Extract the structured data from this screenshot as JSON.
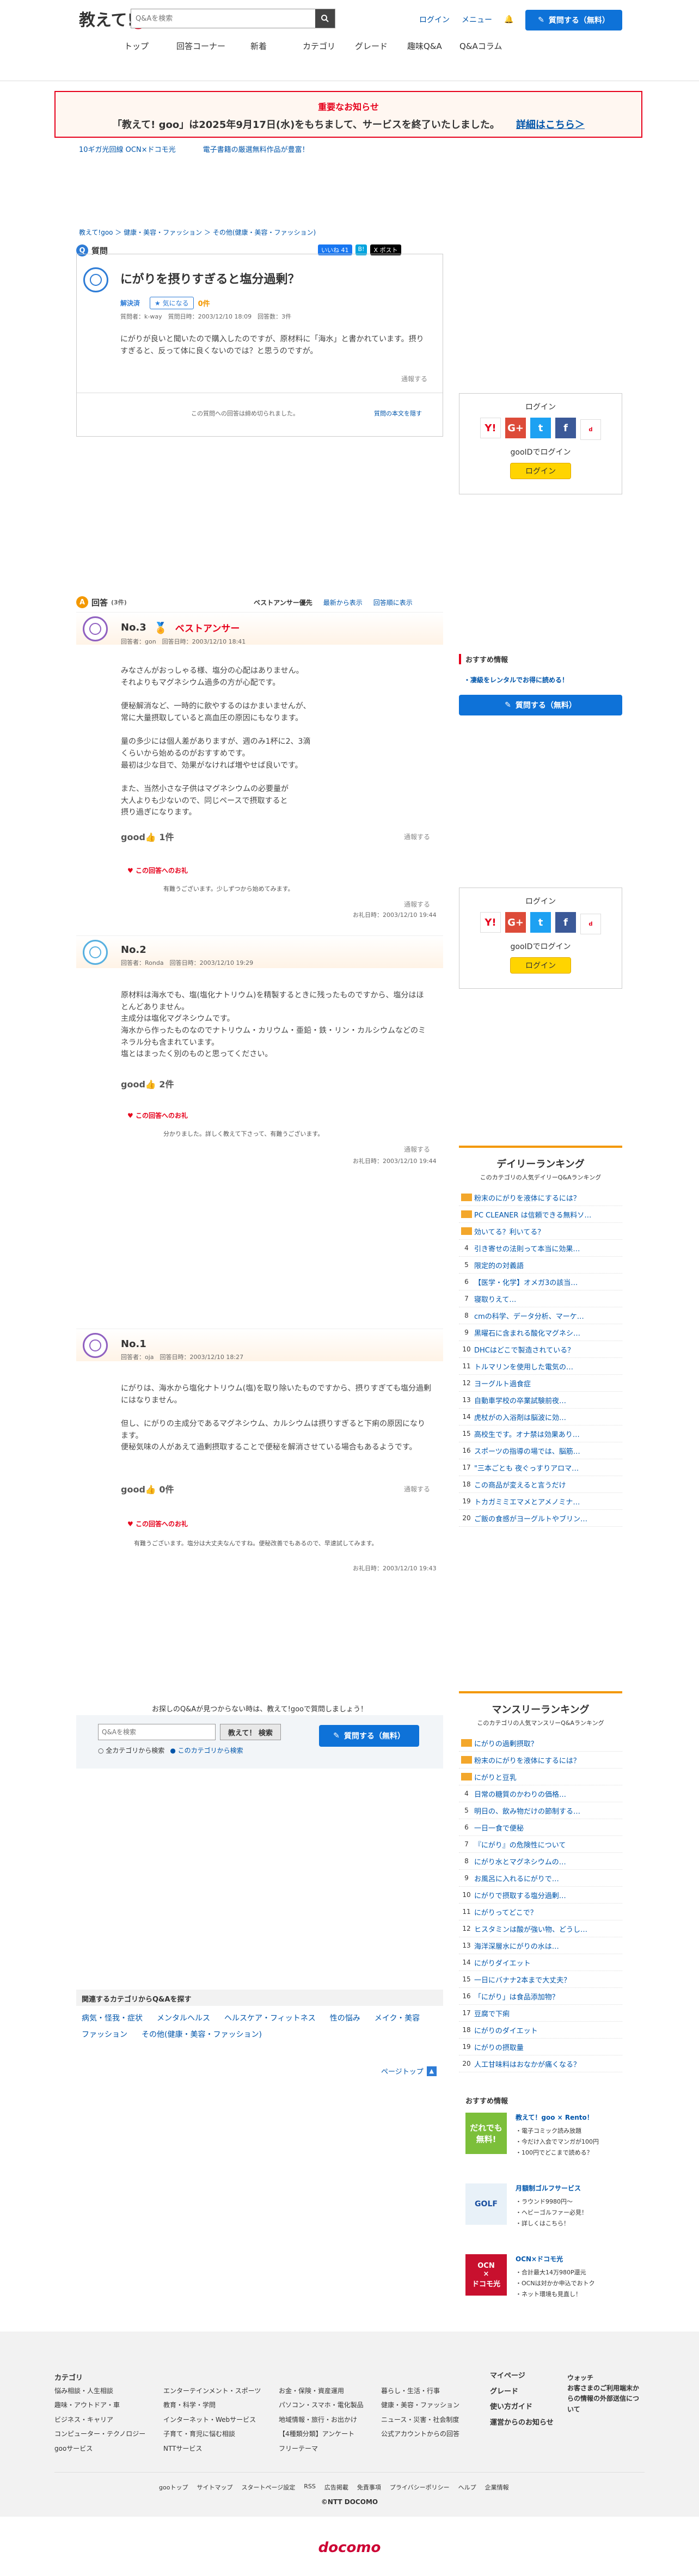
{
  "header": {
    "logo_prefix": "教えて!",
    "logo_brand": "goo",
    "search_placeholder": "Q&Aを検索",
    "login": "ログイン",
    "menu": "メニュー",
    "ask_button": "質問する（無料）"
  },
  "nav": [
    "トップ",
    "回答コーナー",
    "新着",
    "カテゴリ",
    "グレード",
    "趣味Q&A",
    "Q&Aコラム"
  ],
  "notice": {
    "title": "重要なお知らせ",
    "message": "「教えて! goo」は2025年9月17日(水)をもちまして、サービスを終了いたしました。",
    "link": "詳細はこちら＞"
  },
  "promo": [
    "10ギガ光回線 OCN×ドコモ光",
    "電子書籍の厳選無料作品が豊富！"
  ],
  "breadcrumb": [
    "教えて!goo",
    "健康・美容・ファッション",
    "その他(健康・美容・ファッション)"
  ],
  "question": {
    "section": "質問",
    "share": [
      "いいね 41",
      "X ポスト"
    ],
    "title": "にがりを摂りすぎると塩分過剰？",
    "status": "解決済",
    "helped": "気になる",
    "helped_count": "0件",
    "meta": "質問者：k-way　質問日時：2003/12/10 18:09　回答数：3件",
    "body": "にがりが良いと聞いたので購入したのですが、原材料に「海水」と書かれています。摂りすぎると、反って体に良くないのでは？と思うのですが。",
    "report": "通報する",
    "closed": "この質問への回答は締め切られました。",
    "show_all": "質問の本文を隠す"
  },
  "answers": {
    "section": "回答",
    "count": "(3件)",
    "tabs": [
      "ベストアンサー優先",
      "最新から表示",
      "回答順に表示"
    ],
    "items": [
      {
        "no": "No.3",
        "badge": "ベストアンサー",
        "meta": "回答者：gon　回答日時：2003/12/10 18:41",
        "body": "みなさんがおっしゃる様、塩分の心配はありません。\nそれよりもマグネシウム過多の方が心配です。\n\n便秘解消など、一時的に飲やするのはかまいませんが、\n常に大量摂取していると高血圧の原因にもなります。\n\n量の多少には個人差がありますが、週のみ1杯に2、3滴\nくらいから始めるのがおすすめです。\n最初は少な目で、効果がなければ増やせば良いです。\n\nまた、当然小さな子供はマグネシウムの必要量が\n大人よりも少ないので、同じペースで摂取すると\n摂り過ぎになります。",
        "good": "1件",
        "report": "通報する",
        "thx_title": "この回答へのお礼",
        "thx": "有難うございます。少しずつから始めてみます。",
        "thx_date": "お礼日時：2003/12/10 19:44"
      },
      {
        "no": "No.2",
        "meta": "回答者：Ronda　回答日時：2003/12/10 19:29",
        "body": "原材料は海水でも、塩(塩化ナトリウム)を精製するときに残ったものですから、塩分はほとんどありません。\n主成分は塩化マグネシウムです。\n海水から作ったものなのでナトリウム・カリウム・亜鉛・鉄・リン・カルシウムなどのミネラル分も含まれています。\n塩とはまったく別のものと思ってください。",
        "good": "2件",
        "report": "通報する",
        "thx_title": "この回答へのお礼",
        "thx": "分かりました。詳しく教えて下さって、有難うございます。",
        "thx_date": "お礼日時：2003/12/10 19:44"
      },
      {
        "no": "No.1",
        "meta": "回答者：oja　回答日時：2003/12/10 18:27",
        "body": "にがりは、海水から塩化ナトリウム(塩)を取り除いたものですから、摂りすぎても塩分過剰にはなりません。\n\n但し、にがりの主成分であるマグネシウム、カルシウムは摂りすぎると下痢の原因になります。\n便秘気味の人があえて過剰摂取することで便秘を解消させている場合もあるようです。",
        "good": "0件",
        "report": "通報する",
        "thx_title": "この回答へのお礼",
        "thx": "有難うございます。塩分は大丈夫なんですね。便秘改善でもあるので、早速試してみます。",
        "thx_date": "お礼日時：2003/12/10 19:43"
      }
    ]
  },
  "sidebar": {
    "login_title": "ログイン",
    "goo_login": "gooIDでログイン",
    "login_button": "ログイン",
    "recommend": "おすすめ情報",
    "rec_link": "・凄級をレンタルでお得に読める！",
    "ask": "質問する（無料）",
    "daily": {
      "title": "デイリーランキング",
      "sub": "このカテゴリの人気デイリーQ&Aランキング",
      "items": [
        "粉末のにがりを液体にするには？",
        "PC CLEANER は信頼できる無料ソ…",
        "効いてる？利いてる？",
        "引き寄せの法則って本当に効果…",
        "限定的の対義語",
        "【医学・化学】オメガ3の該当…",
        "寝取りえて…",
        "cmの科学、データ分析、マーケ…",
        "黒曜石に含まれる酸化マグネシ…",
        "DHCはどこで製造されている？",
        "トルマリンを使用した電気の…",
        "ヨーグルト過食症",
        "自動車学校の卒業試験前夜…",
        "虎杖がの入浴剤は脳波に効…",
        "高校生です。オナ禁は効果あり…",
        "スポーツの指導の場では、脳筋…",
        "\"三本ごとも 夜ぐっすりアロマ…",
        "この商品が変えると言うだけ",
        "トカガミミエマメとアメノミナ…",
        "ご飯の食感がヨーグルトやブリン…"
      ]
    },
    "monthly": {
      "title": "マンスリーランキング",
      "sub": "このカテゴリの人気マンスリーQ&Aランキング",
      "items": [
        "にがりの過剰摂取？",
        "粉末のにがりを液体にするには？",
        "にがりと豆乳",
        "日常の糖質のかわりの価格…",
        "明日の、飲み物だけの節制する…",
        "一日一食で便秘",
        "『にがり』の危険性について",
        "にがり水とマグネシウムの…",
        "お風呂に入れるにがりで…",
        "にがりで摂取する塩分過剰…",
        "にがりってどこで？",
        "ヒスタミンは酸が強い物、どうし…",
        "海洋深層水にがりの水は…",
        "にがりダイエット",
        "一日にバナナ2本まで大丈夫？",
        "「にがり」は食品添加物？",
        "豆腐で下痢",
        "にがりのダイエット",
        "にがりの摂取量",
        "人工甘味料はおなかが痛くなる？"
      ]
    },
    "ads_title": "おすすめ情報",
    "ads": [
      {
        "title": "教えて！goo × Rento！",
        "lines": [
          "・電子コミック読み放題",
          "・今だけ入会でマンガが100円",
          "・100円でどこまで読める？"
        ]
      },
      {
        "title": "月額制ゴルフサービス",
        "lines": [
          "・ラウンド9980円〜",
          "・ヘビーゴルファー必見！",
          "・詳しくはこちら！"
        ]
      },
      {
        "title": "OCN×ドコモ光",
        "lines": [
          "・合計最大14万980P還元",
          "・OCNは対かか申込でおトク",
          "・ネット環境も見直し！"
        ]
      }
    ]
  },
  "bottom": {
    "prompt": "お探しのQ&Aが見つからない時は、教えて!gooで質問しましょう！",
    "placeholder": "Q&Aを検索",
    "search_btn": "教えて！ 検索",
    "radio1": "全カテゴリから検索",
    "radio2": "このカテゴリから検索",
    "ask": "質問する（無料）",
    "related_title": "関連するカテゴリからQ&Aを探す",
    "related": [
      "病気・怪我・症状",
      "メンタルヘルス",
      "ヘルスケア・フィットネス",
      "性の悩み",
      "メイク・美容",
      "ファッション",
      "その他(健康・美容・ファッション)"
    ],
    "pagetop": "ページトップ"
  },
  "footer": {
    "cat_title": "カテゴリ",
    "cols": [
      [
        "悩み相談・人生相談",
        "趣味・アウトドア・車",
        "ビジネス・キャリア",
        "コンピューター・テクノロジー",
        "gooサービス"
      ],
      [
        "エンターテインメント・スポーツ",
        "教育・科学・学問",
        "インターネット・Webサービス",
        "子育て・育児に悩む相談",
        "NTTサービス"
      ],
      [
        "お金・保険・資産運用",
        "パソコン・スマホ・電化製品",
        "地域情報・旅行・お出かけ",
        "【4種類分類】アンケート",
        "フリーテーマ"
      ],
      [
        "暮らし・生活・行事",
        "健康・美容・ファッション",
        "ニュース・災害・社会制度",
        "公式アカウントからの回答"
      ]
    ],
    "right1": [
      "マイページ",
      "グレード",
      "使い方ガイド",
      "運営からのお知らせ"
    ],
    "right2": [
      "ウォッチ",
      "お客さまのご利用端末からの情報の外部送信について"
    ],
    "links": [
      "gooトップ",
      "サイトマップ",
      "スタートページ設定",
      "RSS",
      "広告掲載",
      "免責事項",
      "プライバシーポリシー",
      "ヘルプ",
      "企業情報"
    ],
    "copyright": "©NTT DOCOMO",
    "docomo": "docomo"
  }
}
